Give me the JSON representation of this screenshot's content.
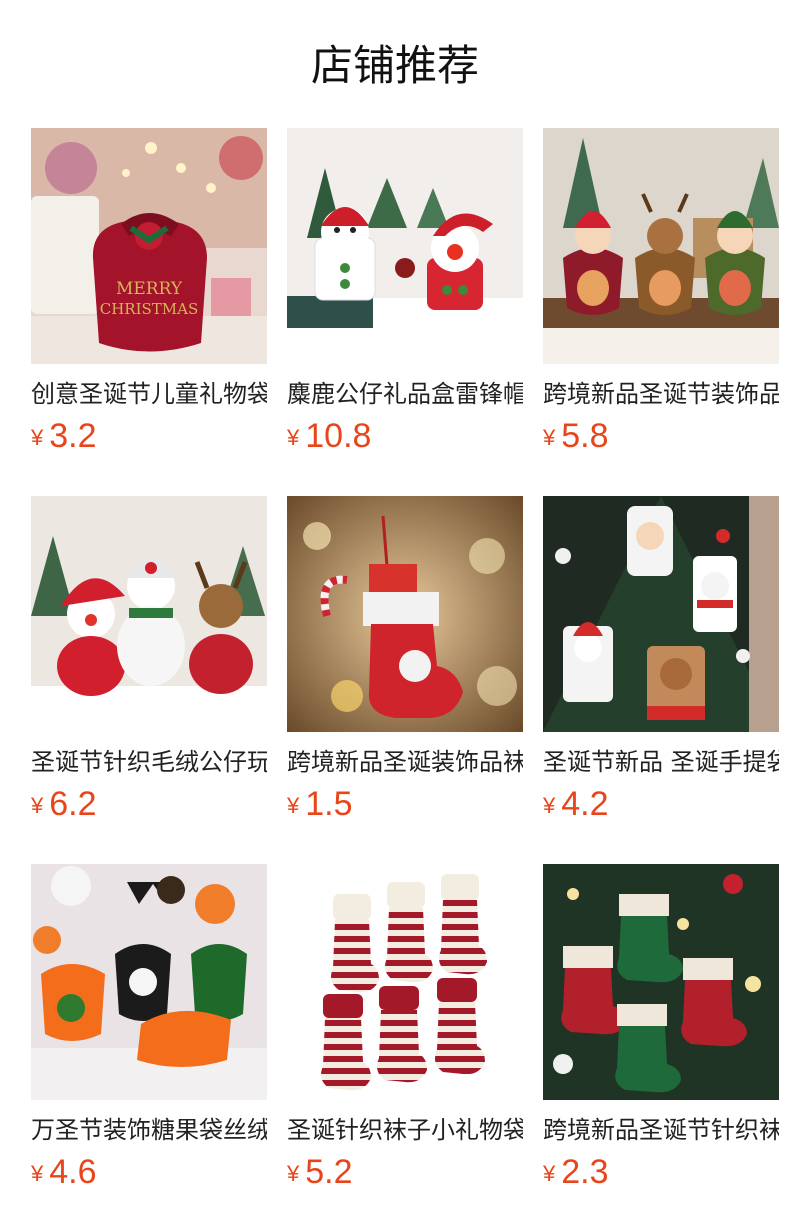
{
  "section": {
    "title": "店铺推荐"
  },
  "currency_symbol": "¥",
  "accent_color": "#e8461a",
  "products": [
    {
      "name": "创意圣诞节儿童礼物袋",
      "price": "3.2",
      "image": "red-velvet-christmas-gift-bag"
    },
    {
      "name": "麋鹿公仔礼品盒雷锋帽",
      "price": "10.8",
      "image": "snowman-and-santa-doll-boxes"
    },
    {
      "name": "跨境新品圣诞节装饰品",
      "price": "5.8",
      "image": "santa-reindeer-candy-bags"
    },
    {
      "name": "圣诞节针织毛绒公仔玩具",
      "price": "6.2",
      "image": "knitted-santa-snowman-reindeer-dolls"
    },
    {
      "name": "跨境新品圣诞装饰品袜子",
      "price": "1.5",
      "image": "red-christmas-stocking-with-snowflake"
    },
    {
      "name": "圣诞节新品 圣诞手提袋",
      "price": "4.2",
      "image": "christmas-tree-hanging-gift-bags"
    },
    {
      "name": "万圣节装饰糖果袋丝绒",
      "price": "4.6",
      "image": "halloween-candy-bags"
    },
    {
      "name": "圣诞针织袜子小礼物袋",
      "price": "5.2",
      "image": "striped-knitted-stockings"
    },
    {
      "name": "跨境新品圣诞节针织袜子",
      "price": "2.3",
      "image": "green-red-knitted-stockings-on-tree"
    }
  ]
}
